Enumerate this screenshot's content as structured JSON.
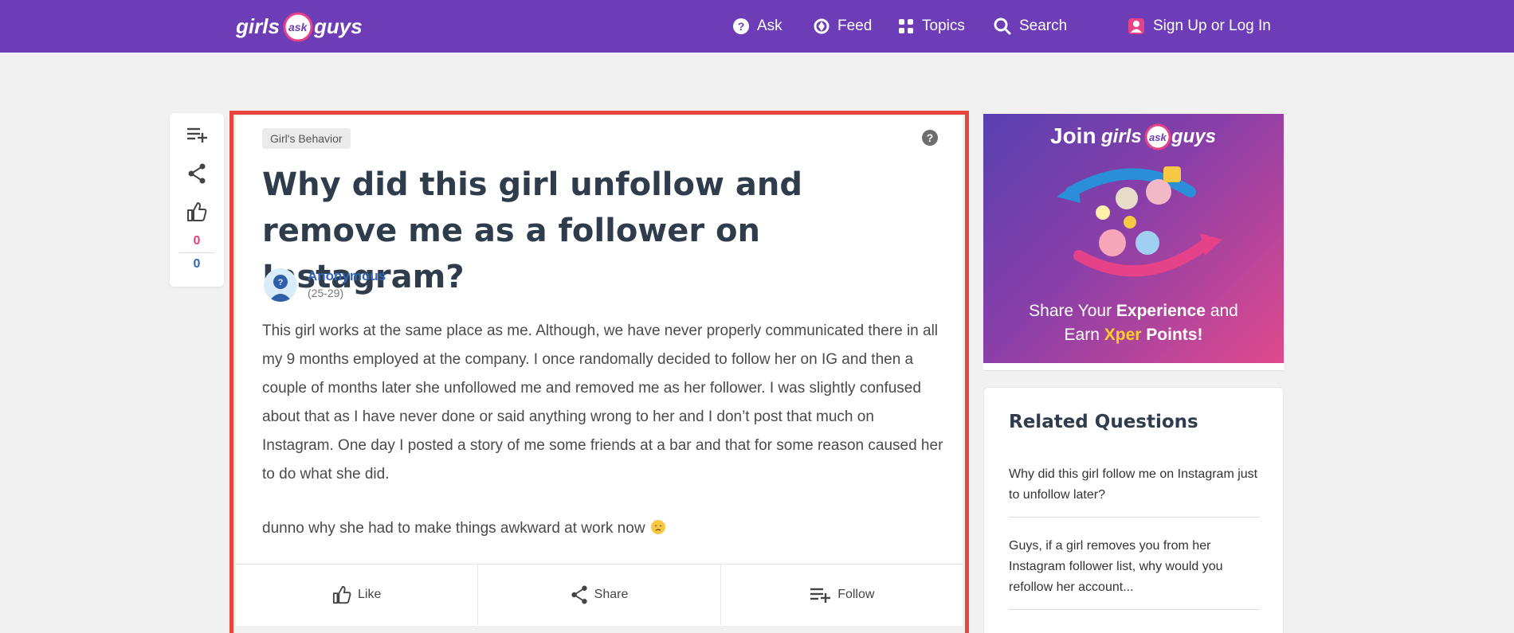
{
  "header": {
    "logo": {
      "part1": "girls",
      "part2": "ask",
      "part3": "guys"
    },
    "nav": [
      {
        "label": "Ask",
        "icon": "question-circle-icon"
      },
      {
        "label": "Feed",
        "icon": "feed-icon"
      },
      {
        "label": "Topics",
        "icon": "grid-icon"
      },
      {
        "label": "Search",
        "icon": "search-icon"
      }
    ],
    "login_label": "Sign Up or Log In",
    "bar_color": "#6d3db8"
  },
  "sidebar_actions": {
    "like_count": "0",
    "dislike_count": "0"
  },
  "question": {
    "tag": "Girl's Behavior",
    "title": "Why did this girl unfollow and remove me as a follower on Instagram?",
    "author": "Anonymous",
    "age": "(25-29)",
    "body": "This girl works at the same place as me. Although, we have never properly communicated there in all my 9 months employed at the company. I once randomally decided to follow her on IG and then a couple of months later she unfollowed me and removed me as her follower. I was slightly confused about that as I have never done or said anything wrong to her and I don’t post that much on Instagram. One day I posted a story of me some friends at a bar and that for some reason caused her to do what she did.",
    "body2": "dunno why she had to make things awkward at work now",
    "actions": {
      "like": "Like",
      "share": "Share",
      "follow": "Follow"
    },
    "highlight_color": "#e8463c"
  },
  "promo": {
    "join": "Join",
    "line1_pre": "Share Your ",
    "line1_bold": "Experience",
    "line1_post": " and",
    "line2_pre": "Earn ",
    "line2_xper": "Xper",
    "line2_post": " Points!"
  },
  "related": {
    "heading": "Related Questions",
    "items": [
      "Why did this girl follow me on Instagram just to unfollow later?",
      "Guys, if a girl removes you from her Instagram follower list, why would you refollow her account..."
    ]
  }
}
